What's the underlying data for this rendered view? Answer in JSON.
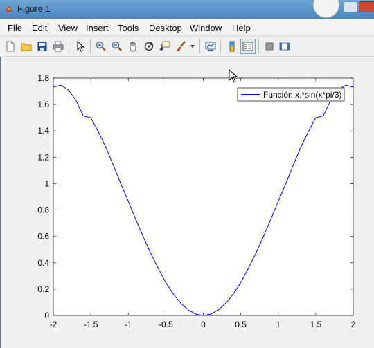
{
  "window": {
    "title": "Figure 1"
  },
  "menu": [
    "File",
    "Edit",
    "View",
    "Insert",
    "Tools",
    "Desktop",
    "Window",
    "Help"
  ],
  "toolbar": {
    "buttons": [
      "new-figure",
      "open-file",
      "save",
      "print",
      "edit-plot",
      "zoom-in",
      "zoom-out",
      "pan",
      "rotate-3d",
      "data-cursor",
      "brush",
      "brush-dropdown",
      "link-plot",
      "insert-colorbar",
      "insert-legend",
      "hide-plot-tools",
      "show-plot-tools"
    ]
  },
  "colors": {
    "line": "#0000ff",
    "axes_bg": "#ffffff",
    "figure_bg": "#f0f0f0"
  },
  "chart_data": {
    "type": "line",
    "title": "",
    "xlabel": "",
    "ylabel": "",
    "xlim": [
      -2,
      2
    ],
    "ylim": [
      0,
      1.8
    ],
    "xticks": [
      -2,
      -1.5,
      -1,
      -0.5,
      0,
      0.5,
      1,
      1.5,
      2
    ],
    "yticks": [
      0,
      0.2,
      0.4,
      0.6,
      0.8,
      1,
      1.2,
      1.4,
      1.6,
      1.8
    ],
    "xtick_labels": [
      "-2",
      "-1.5",
      "-1",
      "-0.5",
      "0",
      "0.5",
      "1",
      "1.5",
      "2"
    ],
    "ytick_labels": [
      "0",
      "0.2",
      "0.4",
      "0.6",
      "0.8",
      "1",
      "1.2",
      "1.4",
      "1.6",
      "1.8"
    ],
    "legend": {
      "position": "top-right",
      "entries": [
        "Función x.*sin(x*pi/3)"
      ]
    },
    "grid": false,
    "series": [
      {
        "name": "Función x.*sin(x*pi/3)",
        "x": [
          -2,
          -1.9,
          -1.8,
          -1.7,
          -1.6,
          -1.5,
          -1.4,
          -1.3,
          -1.2,
          -1.1,
          -1,
          -0.9,
          -0.8,
          -0.7,
          -0.6,
          -0.5,
          -0.4,
          -0.3,
          -0.2,
          -0.1,
          0,
          0.1,
          0.2,
          0.3,
          0.4,
          0.5,
          0.6,
          0.7,
          0.8,
          0.9,
          1,
          1.1,
          1.2,
          1.3,
          1.4,
          1.5,
          1.6,
          1.7,
          1.8,
          1.9,
          2
        ],
        "y": [
          1.732,
          1.746,
          1.712,
          1.633,
          1.514,
          1.5,
          1.394,
          1.276,
          1.141,
          0.999,
          0.866,
          0.728,
          0.596,
          0.471,
          0.357,
          0.25,
          0.163,
          0.093,
          0.042,
          0.01,
          0,
          0.01,
          0.042,
          0.093,
          0.163,
          0.25,
          0.357,
          0.471,
          0.596,
          0.728,
          0.866,
          0.999,
          1.141,
          1.276,
          1.394,
          1.5,
          1.514,
          1.633,
          1.712,
          1.746,
          1.732
        ]
      }
    ]
  }
}
